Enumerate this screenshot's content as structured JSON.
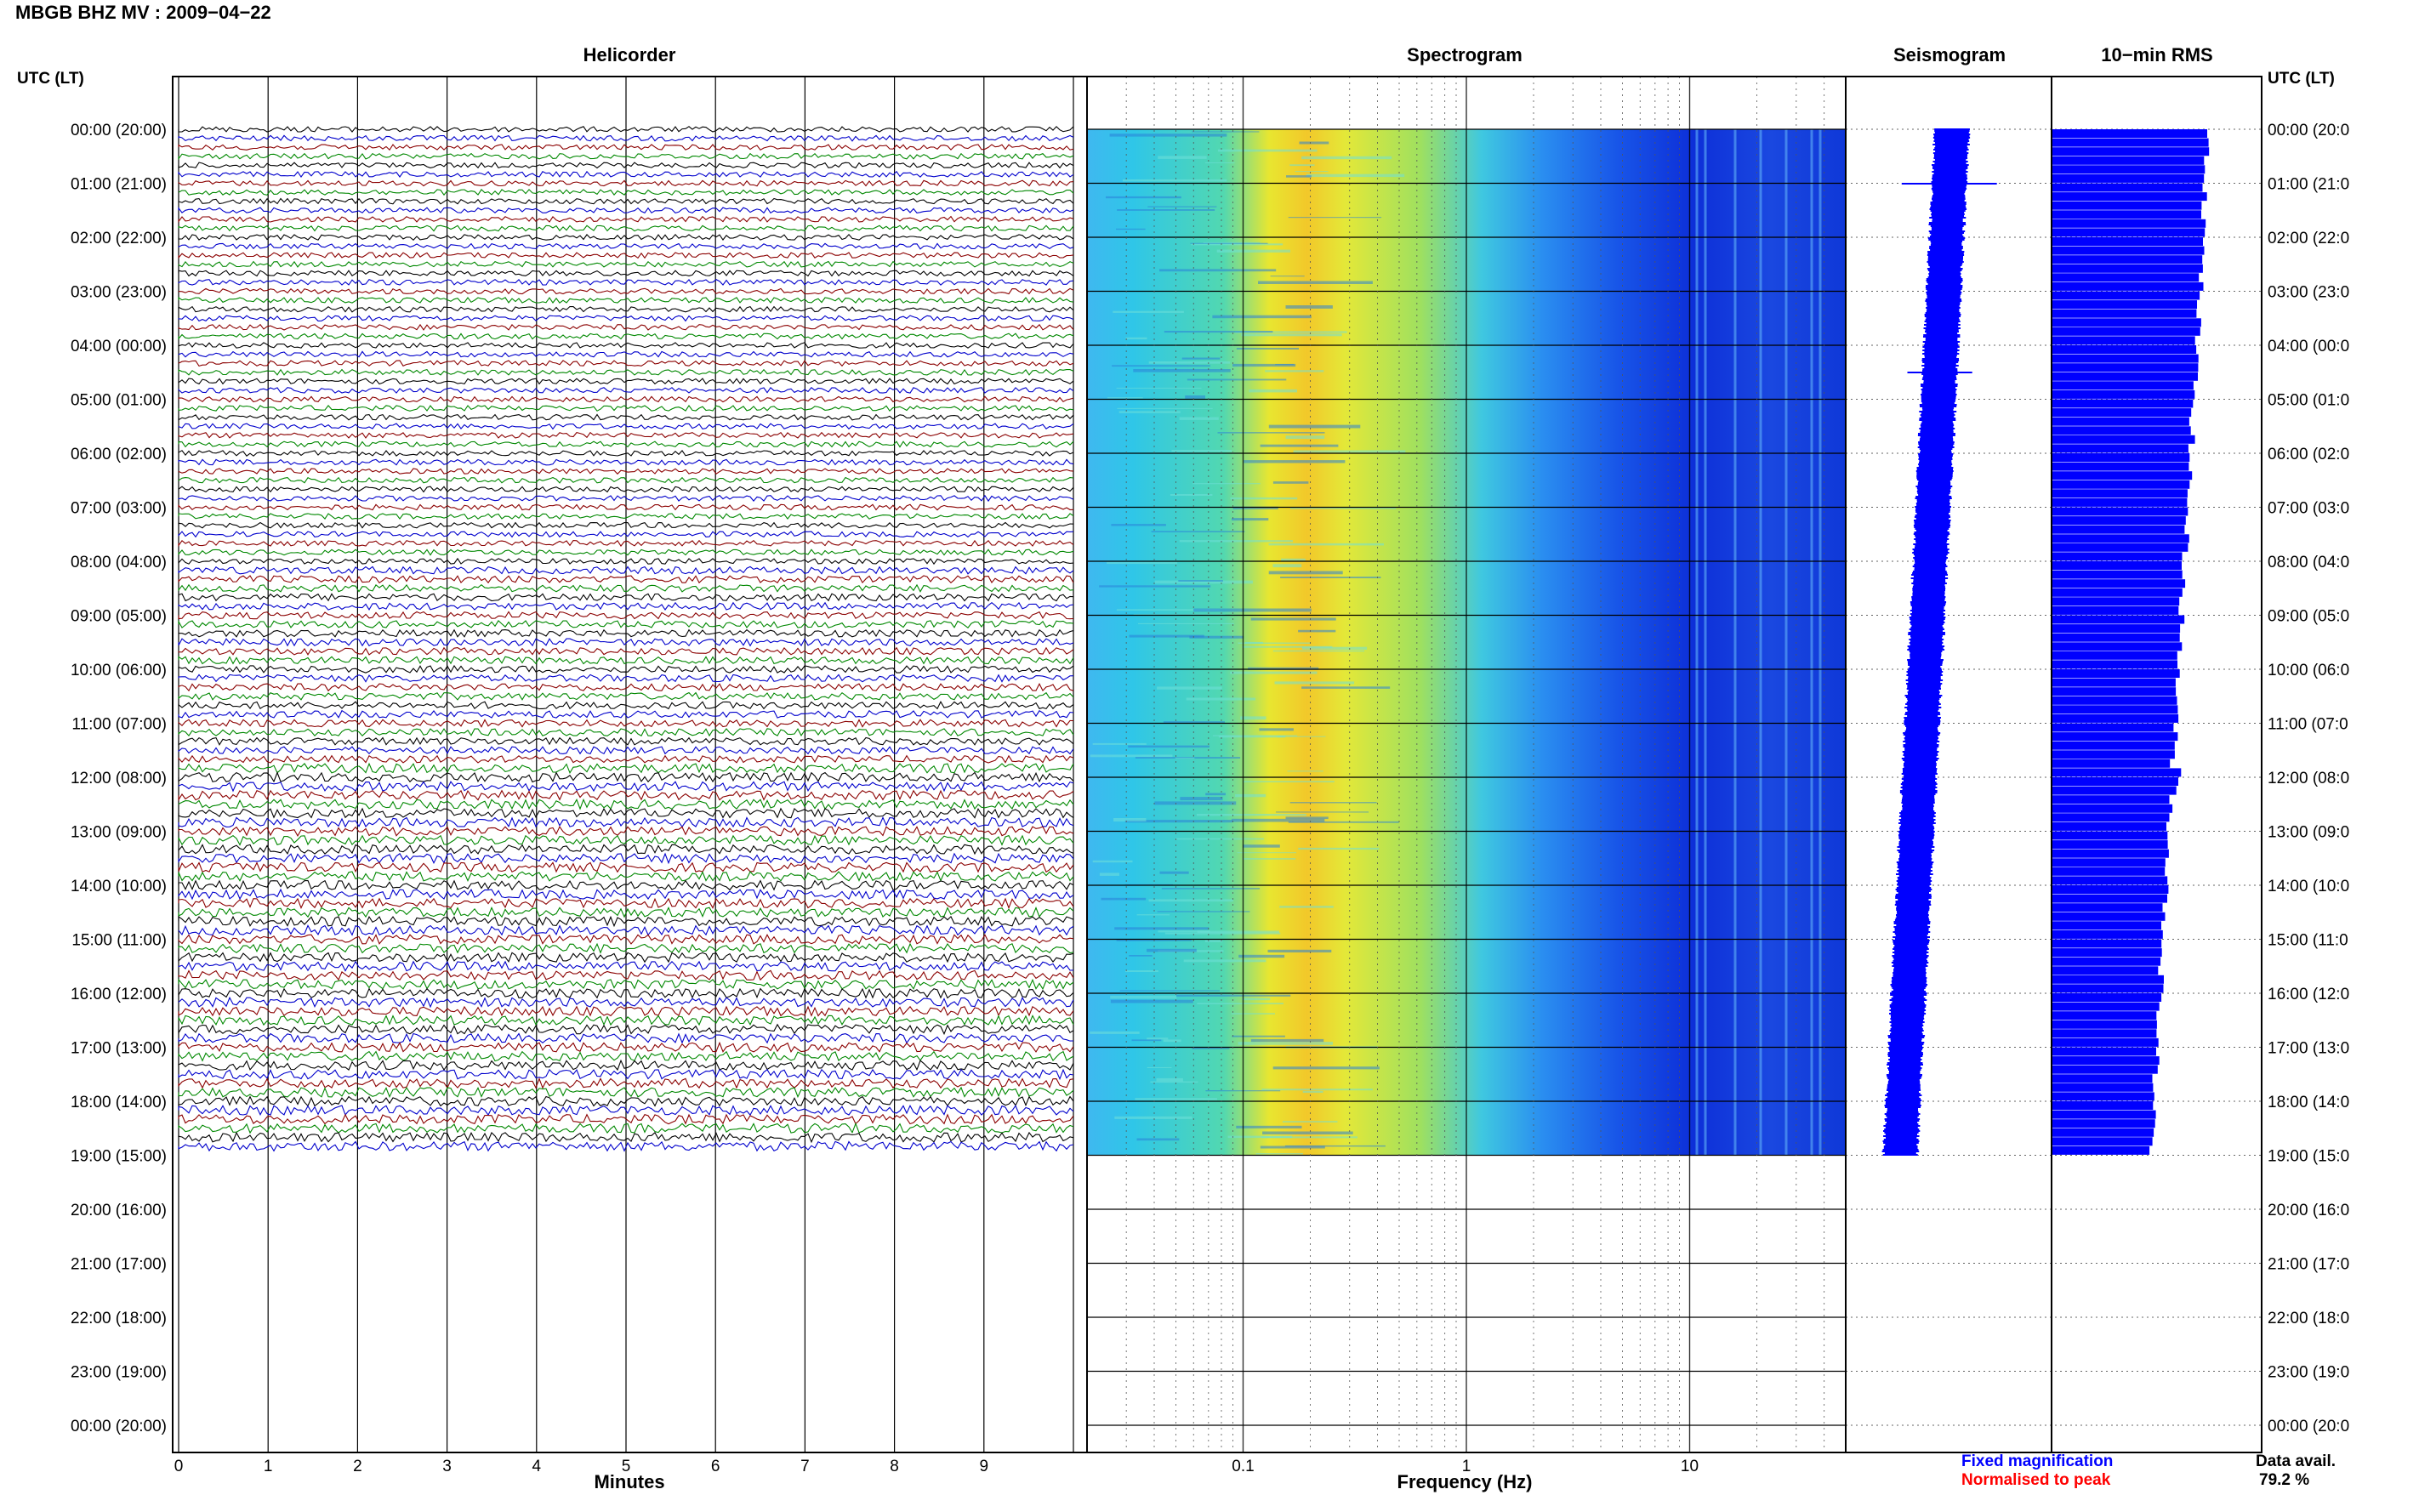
{
  "header": {
    "title": "MBGB BHZ MV : 2009−04−22"
  },
  "panels": {
    "helicorder": "Helicorder",
    "spectrogram": "Spectrogram",
    "seismogram": "Seismogram",
    "rms": "10−min RMS"
  },
  "axis": {
    "left_header": "UTC (LT)",
    "right_header": "UTC (LT)",
    "minutes_label": "Minutes",
    "frequency_label": "Frequency (Hz)"
  },
  "legend": {
    "fixed": "Fixed magnification",
    "fixed_color": "#0000ff",
    "normalised": "Normalised to peak",
    "normalised_color": "#ff0000"
  },
  "data_avail": {
    "label": "Data avail.",
    "value": "79.2 %"
  },
  "chart_data": {
    "type": "helicorder",
    "hour_labels_left": [
      "00:00 (20:00)",
      "01:00 (21:00)",
      "02:00 (22:00)",
      "03:00 (23:00)",
      "04:00 (00:00)",
      "05:00 (01:00)",
      "06:00 (02:00)",
      "07:00 (03:00)",
      "08:00 (04:00)",
      "09:00 (05:00)",
      "10:00 (06:00)",
      "11:00 (07:00)",
      "12:00 (08:00)",
      "13:00 (09:00)",
      "14:00 (10:00)",
      "15:00 (11:00)",
      "16:00 (12:00)",
      "17:00 (13:00)",
      "18:00 (14:00)",
      "19:00 (15:00)",
      "20:00 (16:00)",
      "21:00 (17:00)",
      "22:00 (18:00)",
      "23:00 (19:00)",
      "00:00 (20:00)"
    ],
    "hour_labels_right": [
      "00:00 (20:0",
      "01:00 (21:0",
      "02:00 (22:0",
      "03:00 (23:0",
      "04:00 (00:0",
      "05:00 (01:0",
      "06:00 (02:0",
      "07:00 (03:0",
      "08:00 (04:0",
      "09:00 (05:0",
      "10:00 (06:0",
      "11:00 (07:0",
      "12:00 (08:0",
      "13:00 (09:0",
      "14:00 (10:0",
      "15:00 (11:0",
      "16:00 (12:0",
      "17:00 (13:0",
      "18:00 (14:0",
      "19:00 (15:0",
      "20:00 (16:0",
      "21:00 (17:0",
      "22:00 (18:0",
      "23:00 (19:0",
      "00:00 (20:0"
    ],
    "minutes_ticks": [
      "0",
      "1",
      "2",
      "3",
      "4",
      "5",
      "6",
      "7",
      "8",
      "9"
    ],
    "frequency_ticks": [
      "0.1",
      "1",
      "10"
    ],
    "frequency_range_hz": [
      0.02,
      50
    ],
    "minutes_range": [
      0,
      10
    ],
    "data_end_hour": 19,
    "trace_colors": [
      "#000000",
      "#0000cc",
      "#8b0000",
      "#008800"
    ],
    "traces_per_hour": 6
  }
}
